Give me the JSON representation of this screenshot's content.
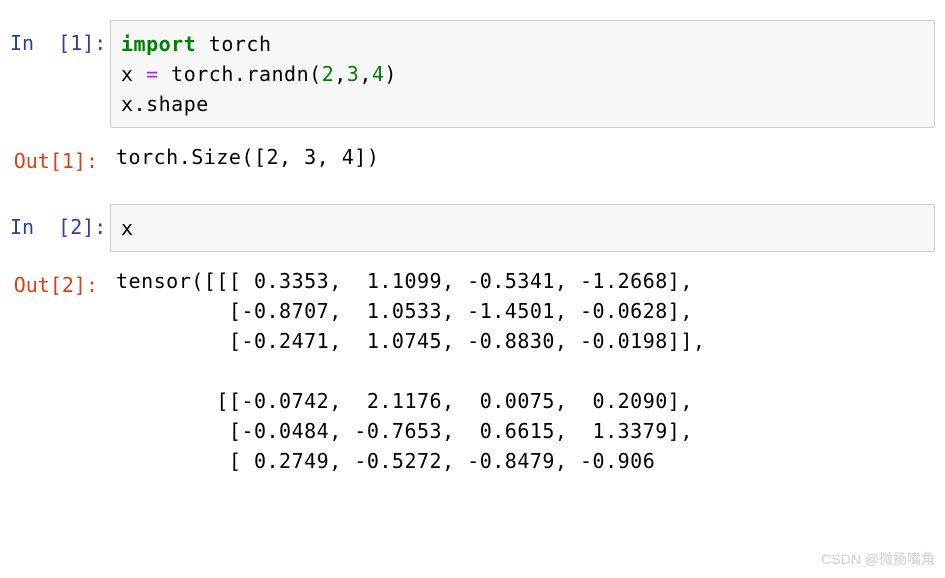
{
  "cells": [
    {
      "prompt_in": "In  [1]:",
      "code": {
        "kw": "import",
        "mod": " torch",
        "line2_pre": "x ",
        "op": "=",
        "line2_post": " torch.randn",
        "lp": "(",
        "n1": "2",
        "c1": ",",
        "n2": "3",
        "c2": ",",
        "n3": "4",
        "rp": ")",
        "line3": "x.shape"
      },
      "prompt_out": "Out[1]:",
      "output": "torch.Size([2, 3, 4])"
    },
    {
      "prompt_in": "In  [2]:",
      "code": {
        "line1": "x"
      },
      "prompt_out": "Out[2]:",
      "output": "tensor([[[ 0.3353,  1.1099, -0.5341, -1.2668],\n         [-0.8707,  1.0533, -1.4501, -0.0628],\n         [-0.2471,  1.0745, -0.8830, -0.0198]],\n\n        [[-0.0742,  2.1176,  0.0075,  0.2090],\n         [-0.0484, -0.7653,  0.6615,  1.3379],\n         [ 0.2749, -0.5272, -0.8479, -0.906"
    }
  ],
  "chart_data": {
    "type": "table",
    "title": "tensor values (torch.randn(2,3,4))",
    "shape": [
      2,
      3,
      4
    ],
    "data": [
      [
        [
          0.3353,
          1.1099,
          -0.5341,
          -1.2668
        ],
        [
          -0.8707,
          1.0533,
          -1.4501,
          -0.0628
        ],
        [
          -0.2471,
          1.0745,
          -0.883,
          -0.0198
        ]
      ],
      [
        [
          -0.0742,
          2.1176,
          0.0075,
          0.209
        ],
        [
          -0.0484,
          -0.7653,
          0.6615,
          1.3379
        ],
        [
          0.2749,
          -0.5272,
          -0.8479,
          -0.906
        ]
      ]
    ]
  },
  "watermark": "CSDN @微扬嘴角"
}
